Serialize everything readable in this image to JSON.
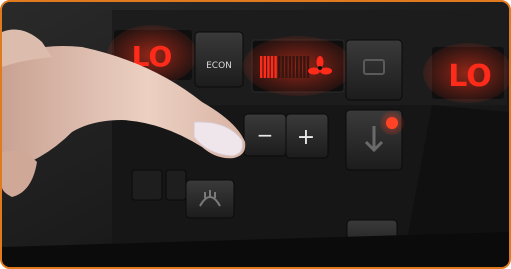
{
  "photo": {
    "left_display": {
      "text": "LO"
    },
    "center_button": {
      "label": "ECON"
    },
    "right_display": {
      "text": "LO"
    },
    "fan_minus": {
      "label": "−"
    },
    "fan_plus": {
      "label": "+"
    },
    "fan_level_display": {
      "level_fraction": 0.35
    },
    "colors": {
      "frame_border": "#e07a1f",
      "display_red": "#ff2b1a",
      "panel_dark": "#1a1a1a",
      "skin": "#e8c7b5"
    }
  }
}
